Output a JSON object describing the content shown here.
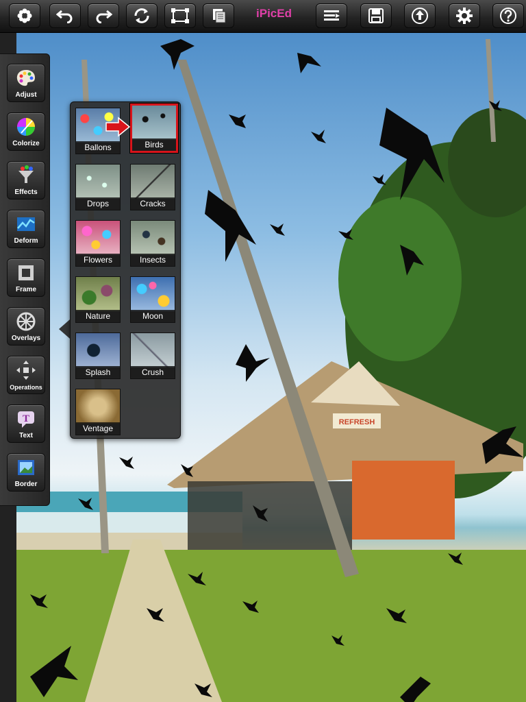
{
  "app": {
    "title": "iPicEd"
  },
  "toolbar": {
    "left": [
      {
        "name": "flower-menu-button",
        "icon": "flower-icon"
      },
      {
        "name": "undo-button",
        "icon": "undo-icon"
      },
      {
        "name": "redo-button",
        "icon": "redo-icon"
      },
      {
        "name": "rotate-button",
        "icon": "rotate-icon"
      },
      {
        "name": "crop-button",
        "icon": "crop-icon"
      },
      {
        "name": "layers-button",
        "icon": "layers-icon"
      }
    ],
    "right": [
      {
        "name": "compare-button",
        "icon": "compare-icon"
      },
      {
        "name": "save-button",
        "icon": "floppy-icon"
      },
      {
        "name": "share-button",
        "icon": "upload-icon"
      },
      {
        "name": "settings-button",
        "icon": "gear-icon"
      },
      {
        "name": "help-button",
        "icon": "question-icon"
      }
    ]
  },
  "tools": [
    {
      "label": "Adjust",
      "icon": "palette-icon"
    },
    {
      "label": "Colorize",
      "icon": "color-wheel-icon"
    },
    {
      "label": "Effects",
      "icon": "funnel-icon"
    },
    {
      "label": "Deform",
      "icon": "wave-icon"
    },
    {
      "label": "Frame",
      "icon": "frame-icon"
    },
    {
      "label": "Overlays",
      "icon": "wheel-icon"
    },
    {
      "label": "Operations",
      "icon": "arrows-icon"
    },
    {
      "label": "Text",
      "icon": "text-bubble-icon"
    },
    {
      "label": "Border",
      "icon": "border-icon"
    }
  ],
  "overlays": {
    "selected": "Birds",
    "items": [
      {
        "label": "Ballons",
        "color": "#5a7da8"
      },
      {
        "label": "Birds",
        "color": "#6a8a9a"
      },
      {
        "label": "Drops",
        "color": "#7d8f86"
      },
      {
        "label": "Cracks",
        "color": "#6e7b72"
      },
      {
        "label": "Flowers",
        "color": "#c9527a"
      },
      {
        "label": "Insects",
        "color": "#7a8a7a"
      },
      {
        "label": "Nature",
        "color": "#6f7f4a"
      },
      {
        "label": "Moon",
        "color": "#3e6fb0"
      },
      {
        "label": "Splash",
        "color": "#4d6a9a"
      },
      {
        "label": "Crush",
        "color": "#8a9aa0"
      },
      {
        "label": "Ventage",
        "color": "#b08a4a"
      }
    ]
  },
  "photo": {
    "sign_text": "REFRESH"
  },
  "colors": {
    "title": "#e03fa8",
    "selection": "#d8141b"
  }
}
